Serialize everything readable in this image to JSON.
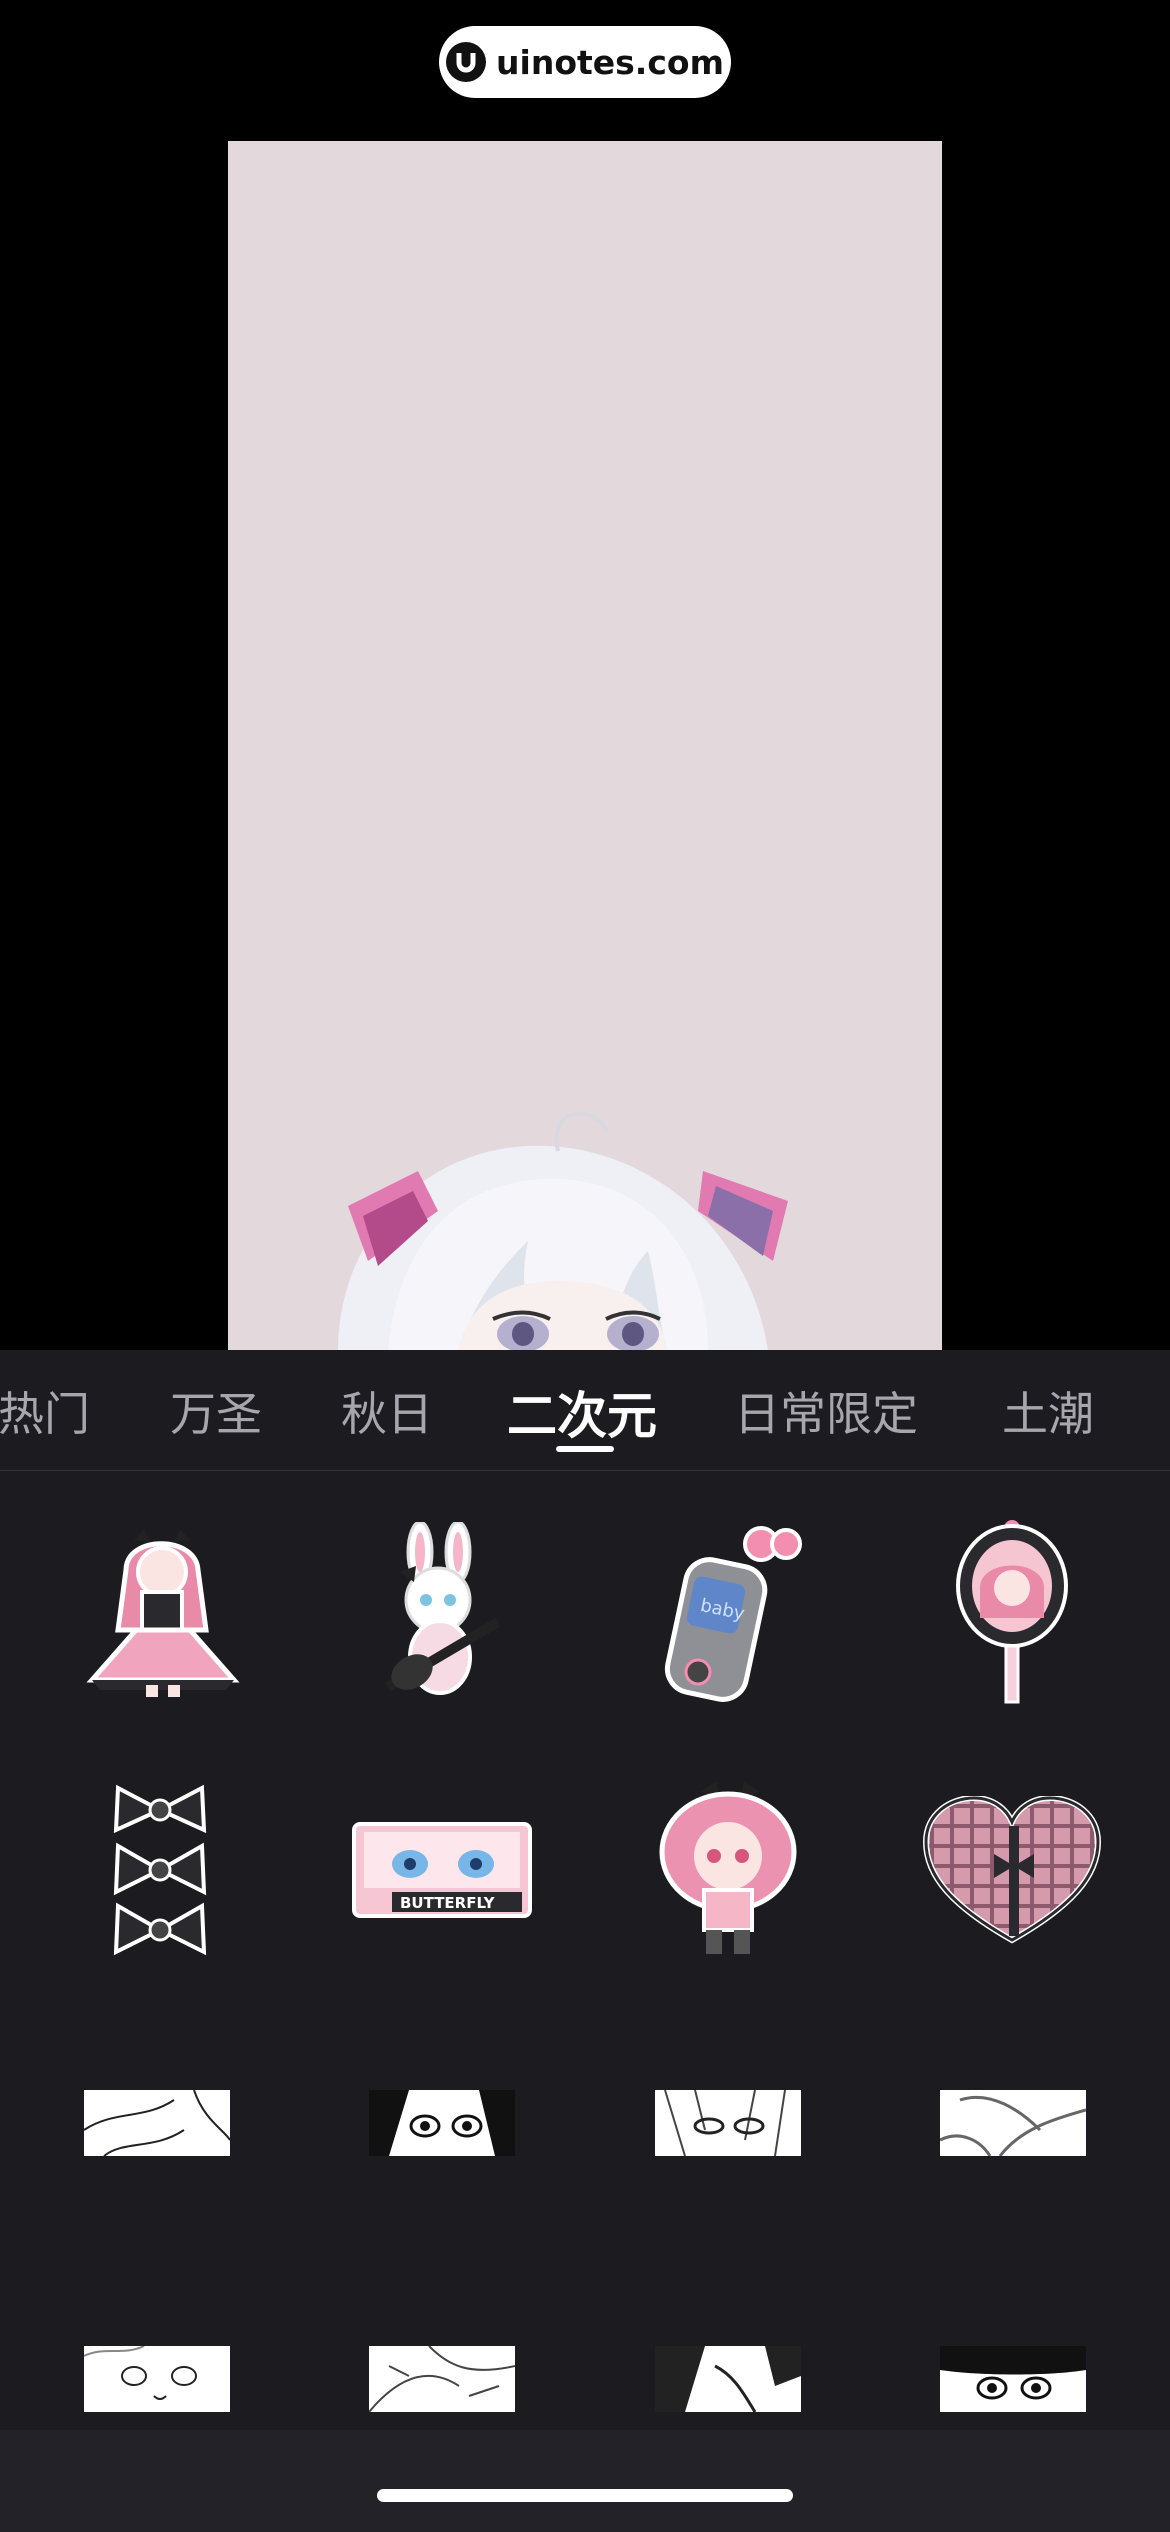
{
  "watermark": {
    "text": "uinotes.com"
  },
  "tabs": [
    {
      "label": "热门"
    },
    {
      "label": "万圣"
    },
    {
      "label": "秋日"
    },
    {
      "label": "二次元",
      "active": true
    },
    {
      "label": "日常限定"
    },
    {
      "label": "土潮"
    }
  ],
  "stickers_row1": [
    "anime-girl-pink-dress-sticker",
    "bunny-guitar-sticker",
    "flip-phone-baby-sticker",
    "mirror-girl-sticker"
  ],
  "stickers_row2": [
    "black-bows-sticker",
    "butterfly-eyes-sticker",
    "chibi-girl-sticker",
    "plaid-heart-sticker"
  ],
  "sticker_texts": {
    "phone": "baby",
    "eyes_banner": "BUTTERFLY"
  },
  "colors": {
    "panel_bg": "#1c1b20",
    "canvas_bg": "#e3d9dd",
    "active_tab": "#ffffff",
    "inactive_tab": "#a7a6ad"
  }
}
